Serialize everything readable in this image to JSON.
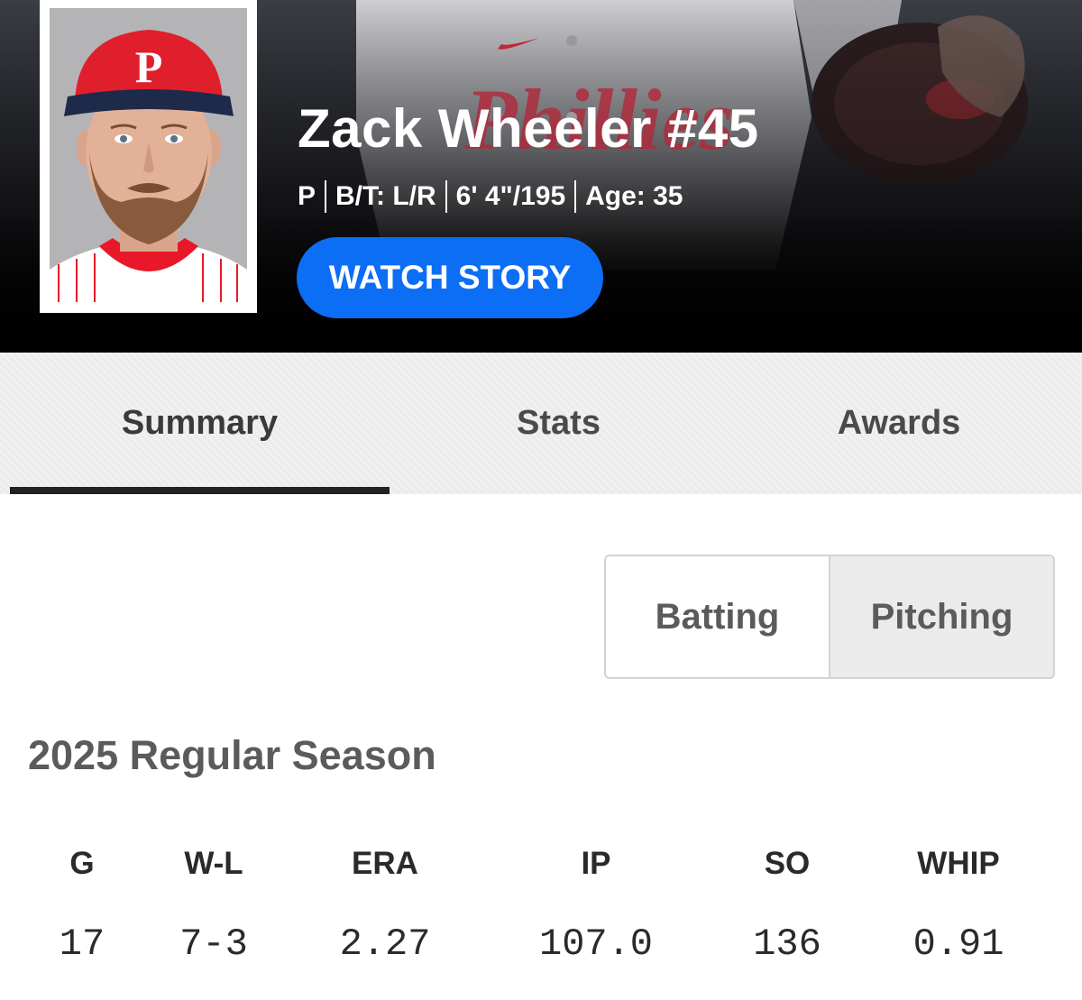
{
  "player": {
    "name": "Zack Wheeler #45",
    "position": "P",
    "bats_throws": "B/T: L/R",
    "height_weight": "6' 4\"/195",
    "age": "Age: 35",
    "cap_logo": "P",
    "jersey_text": "Phillies"
  },
  "hero": {
    "watch_label": "WATCH STORY",
    "accent": "#0c6ef5"
  },
  "tabs": [
    {
      "label": "Summary",
      "active": true
    },
    {
      "label": "Stats",
      "active": false
    },
    {
      "label": "Awards",
      "active": false
    }
  ],
  "toggle": {
    "options": [
      "Batting",
      "Pitching"
    ],
    "selected": "Pitching"
  },
  "season": {
    "title": "2025 Regular Season",
    "stats": [
      {
        "label": "G",
        "value": "17"
      },
      {
        "label": "W-L",
        "value": "7-3"
      },
      {
        "label": "ERA",
        "value": "2.27"
      },
      {
        "label": "IP",
        "value": "107.0"
      },
      {
        "label": "SO",
        "value": "136"
      },
      {
        "label": "WHIP",
        "value": "0.91"
      }
    ]
  },
  "colors": {
    "team_red": "#e81828",
    "tab_underline": "#222222"
  }
}
